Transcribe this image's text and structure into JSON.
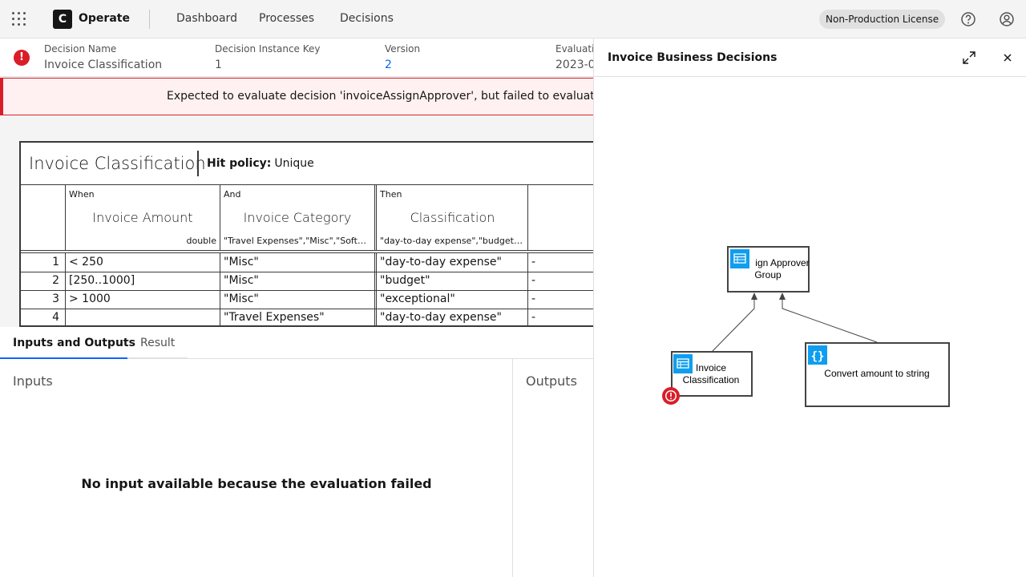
{
  "topbar": {
    "app_menu_icon": "app-switcher-icon",
    "brand": "Operate",
    "logo_letter": "C",
    "nav": [
      "Dashboard",
      "Processes",
      "Decisions"
    ],
    "license": "Non-Production License",
    "help_icon": "help-icon",
    "user_icon": "user-icon"
  },
  "instance_header": {
    "state_icon": "error-icon",
    "fields": [
      {
        "label": "Decision Name",
        "value": "Invoice Classification"
      },
      {
        "label": "Decision Instance Key",
        "value": "1"
      },
      {
        "label": "Version",
        "value": "2"
      },
      {
        "label": "Evaluation",
        "value": "2023-0"
      }
    ]
  },
  "error_message": "Expected to evaluate decision 'invoiceAssignApprover', but failed to evaluate expre",
  "decision_table": {
    "title": "Invoice Classification",
    "hit_policy_label": "Hit policy:",
    "hit_policy": "Unique",
    "columns": [
      {
        "kind": "When",
        "name": "Invoice Amount",
        "type": "double"
      },
      {
        "kind": "And",
        "name": "Invoice Category",
        "type": "\"Travel Expenses\",\"Misc\",\"Softw..."
      },
      {
        "kind": "Then",
        "name": "Classification",
        "type": "\"day-to-day expense\",\"budget\",..."
      }
    ],
    "rows": [
      {
        "index": "1",
        "cells": [
          "< 250",
          "\"Misc\"",
          "\"day-to-day expense\"",
          "-"
        ]
      },
      {
        "index": "2",
        "cells": [
          "[250..1000]",
          "\"Misc\"",
          "\"budget\"",
          "-"
        ]
      },
      {
        "index": "3",
        "cells": [
          "> 1000",
          "\"Misc\"",
          "\"exceptional\"",
          "-"
        ]
      },
      {
        "index": "4",
        "cells": [
          "",
          "\"Travel Expenses\"",
          "\"day-to-day expense\"",
          "-"
        ]
      }
    ]
  },
  "tabs": [
    "Inputs and Outputs",
    "Result"
  ],
  "inputs_title": "Inputs",
  "outputs_title": "Outputs",
  "inputs_empty": "No input available because the evaluation failed",
  "drd_panel": {
    "title": "Invoice Business Decisions",
    "maximize_icon": "maximize-icon",
    "close_icon": "close-icon",
    "nodes": {
      "assign_line1": "ign Approver",
      "assign_line2": "Group",
      "classification_line1": "Invoice",
      "classification_line2": "Classification",
      "convert": "Convert amount to string"
    },
    "table_icon": "decision-table-icon",
    "literal_icon": "literal-expression-icon",
    "error_badge_icon": "error-badge-icon"
  },
  "colors": {
    "error": "#da1e28",
    "link": "#0f62fe",
    "drd_icon": "#0f9eef"
  }
}
